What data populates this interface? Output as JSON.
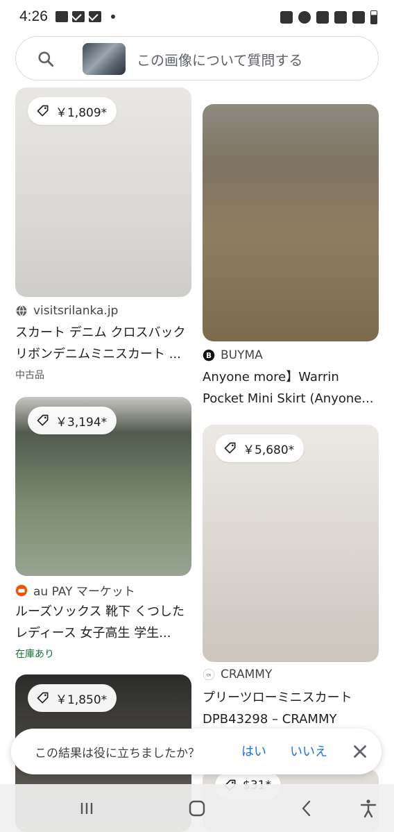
{
  "status_bar": {
    "time": "4:26"
  },
  "search": {
    "placeholder": "この画像について質問する"
  },
  "results": [
    {
      "price": "￥1,809*",
      "source": "visitsrilanka.jp",
      "title_lines": [
        "スカート デニム クロスバック",
        "リボンデニムミニスカート ..."
      ],
      "meta": "中古品"
    },
    {
      "price": "",
      "source": "BUYMA",
      "title_lines": [
        "Anyone more】Warrin",
        "Pocket Mini Skirt (Anyone..."
      ],
      "meta": ""
    },
    {
      "price": "￥3,194*",
      "source": "au PAY マーケット",
      "title_lines": [
        "ルーズソックス 靴下 くつした",
        "レディース 女子高生 学生..."
      ],
      "meta": "在庫あり"
    },
    {
      "price": "￥5,680*",
      "source": "CRAMMY",
      "title_lines": [
        "プリーツローミニスカート",
        "DPB43298 – CRAMMY"
      ],
      "meta": ""
    },
    {
      "price": "￥1,850*",
      "source": "",
      "title_lines": [],
      "meta": ""
    },
    {
      "price": "$31*",
      "source": "",
      "title_lines": [],
      "meta": ""
    }
  ],
  "feedback": {
    "question": "この結果は役に立ちましたか？",
    "yes": "はい",
    "no": "いいえ"
  },
  "colors": {
    "link_blue": "#1a73e8",
    "in_stock_green": "#137333"
  },
  "icons": [
    "search-icon",
    "price-tag-icon",
    "globe-icon",
    "close-icon",
    "recents-icon",
    "home-icon",
    "back-icon",
    "accessibility-icon"
  ]
}
